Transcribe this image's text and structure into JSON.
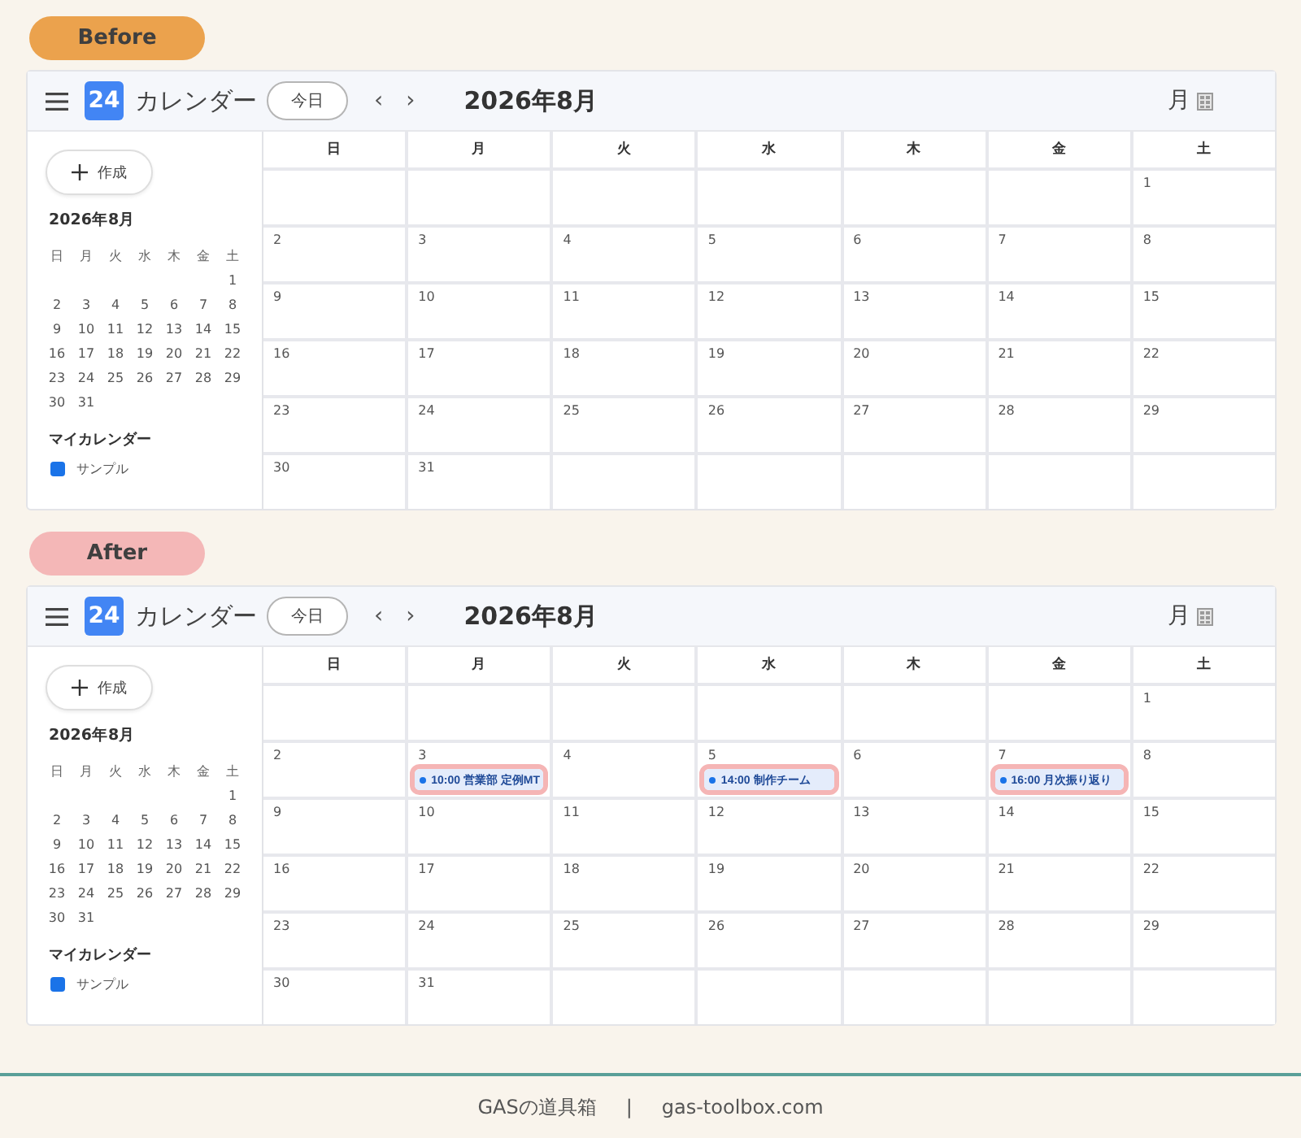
{
  "panels": [
    {
      "badge": {
        "label": "Before",
        "color": "#eba24d"
      },
      "calendar": {
        "header": {
          "logo": "24",
          "title": "カレンダー",
          "today_button": "今日",
          "prev": "‹",
          "next": "›",
          "month": "2026年8月",
          "view": "月"
        },
        "sidebar": {
          "create_button": "作成",
          "mini_month": {
            "title": "2026年8月",
            "weekdays": [
              "日",
              "月",
              "火",
              "水",
              "木",
              "金",
              "土"
            ],
            "weeks": [
              {
                "align_end": true,
                "days": [
                  "1"
                ]
              },
              {
                "days": [
                  "2",
                  "3",
                  "4",
                  "5",
                  "6",
                  "7",
                  "8"
                ]
              },
              {
                "days": [
                  "9",
                  "10",
                  "11",
                  "12",
                  "13",
                  "14",
                  "15"
                ]
              },
              {
                "days": [
                  "16",
                  "17",
                  "18",
                  "19",
                  "20",
                  "21",
                  "22"
                ]
              },
              {
                "days": [
                  "23",
                  "24",
                  "25",
                  "26",
                  "27",
                  "28",
                  "29"
                ]
              },
              {
                "days": [
                  "30",
                  "31"
                ]
              }
            ]
          },
          "section_title": "マイカレンダー",
          "calendars": [
            {
              "name": "サンプル",
              "color": "#1a73e8"
            }
          ]
        },
        "grid": {
          "weekdays": [
            "日",
            "月",
            "火",
            "水",
            "木",
            "金",
            "土"
          ],
          "weeks": [
            {
              "align_end": true,
              "days": [
                {
                  "date": "1"
                }
              ]
            },
            {
              "days": [
                {
                  "date": "2"
                },
                {
                  "date": "3"
                },
                {
                  "date": "4"
                },
                {
                  "date": "5"
                },
                {
                  "date": "6"
                },
                {
                  "date": "7"
                },
                {
                  "date": "8"
                }
              ]
            },
            {
              "days": [
                {
                  "date": "9"
                },
                {
                  "date": "10"
                },
                {
                  "date": "11"
                },
                {
                  "date": "12"
                },
                {
                  "date": "13"
                },
                {
                  "date": "14"
                },
                {
                  "date": "15"
                }
              ]
            },
            {
              "days": [
                {
                  "date": "16"
                },
                {
                  "date": "17"
                },
                {
                  "date": "18"
                },
                {
                  "date": "19"
                },
                {
                  "date": "20"
                },
                {
                  "date": "21"
                },
                {
                  "date": "22"
                }
              ]
            },
            {
              "days": [
                {
                  "date": "23"
                },
                {
                  "date": "24"
                },
                {
                  "date": "25"
                },
                {
                  "date": "26"
                },
                {
                  "date": "27"
                },
                {
                  "date": "28"
                },
                {
                  "date": "29"
                }
              ]
            },
            {
              "days": [
                {
                  "date": "30"
                },
                {
                  "date": "31"
                }
              ]
            }
          ]
        }
      }
    },
    {
      "badge": {
        "label": "After",
        "color": "#f4b7b7"
      },
      "calendar": {
        "header": {
          "logo": "24",
          "title": "カレンダー",
          "today_button": "今日",
          "prev": "‹",
          "next": "›",
          "month": "2026年8月",
          "view": "月"
        },
        "sidebar": {
          "create_button": "作成",
          "mini_month": {
            "title": "2026年8月",
            "weekdays": [
              "日",
              "月",
              "火",
              "水",
              "木",
              "金",
              "土"
            ],
            "weeks": [
              {
                "align_end": true,
                "days": [
                  "1"
                ]
              },
              {
                "days": [
                  "2",
                  "3",
                  "4",
                  "5",
                  "6",
                  "7",
                  "8"
                ]
              },
              {
                "days": [
                  "9",
                  "10",
                  "11",
                  "12",
                  "13",
                  "14",
                  "15"
                ]
              },
              {
                "days": [
                  "16",
                  "17",
                  "18",
                  "19",
                  "20",
                  "21",
                  "22"
                ]
              },
              {
                "days": [
                  "23",
                  "24",
                  "25",
                  "26",
                  "27",
                  "28",
                  "29"
                ]
              },
              {
                "days": [
                  "30",
                  "31"
                ]
              }
            ]
          },
          "section_title": "マイカレンダー",
          "calendars": [
            {
              "name": "サンプル",
              "color": "#1a73e8"
            }
          ]
        },
        "grid": {
          "weekdays": [
            "日",
            "月",
            "火",
            "水",
            "木",
            "金",
            "土"
          ],
          "weeks": [
            {
              "align_end": true,
              "days": [
                {
                  "date": "1"
                }
              ]
            },
            {
              "days": [
                {
                  "date": "2"
                },
                {
                  "date": "3",
                  "events": [
                    {
                      "text": "10:00 営業部 定例MT",
                      "highlighted": true
                    }
                  ]
                },
                {
                  "date": "4"
                },
                {
                  "date": "5",
                  "events": [
                    {
                      "text": "14:00 制作チーム",
                      "highlighted": true
                    }
                  ]
                },
                {
                  "date": "6"
                },
                {
                  "date": "7",
                  "events": [
                    {
                      "text": "16:00 月次振り返り",
                      "highlighted": true
                    }
                  ]
                },
                {
                  "date": "8"
                }
              ]
            },
            {
              "days": [
                {
                  "date": "9"
                },
                {
                  "date": "10"
                },
                {
                  "date": "11"
                },
                {
                  "date": "12"
                },
                {
                  "date": "13"
                },
                {
                  "date": "14"
                },
                {
                  "date": "15"
                }
              ]
            },
            {
              "days": [
                {
                  "date": "16"
                },
                {
                  "date": "17"
                },
                {
                  "date": "18"
                },
                {
                  "date": "19"
                },
                {
                  "date": "20"
                },
                {
                  "date": "21"
                },
                {
                  "date": "22"
                }
              ]
            },
            {
              "days": [
                {
                  "date": "23"
                },
                {
                  "date": "24"
                },
                {
                  "date": "25"
                },
                {
                  "date": "26"
                },
                {
                  "date": "27"
                },
                {
                  "date": "28"
                },
                {
                  "date": "29"
                }
              ]
            },
            {
              "days": [
                {
                  "date": "30"
                },
                {
                  "date": "31"
                }
              ]
            }
          ]
        }
      }
    }
  ],
  "footer": {
    "site_name": "GASの道具箱",
    "separator": "|",
    "url": "gas-toolbox.com"
  }
}
